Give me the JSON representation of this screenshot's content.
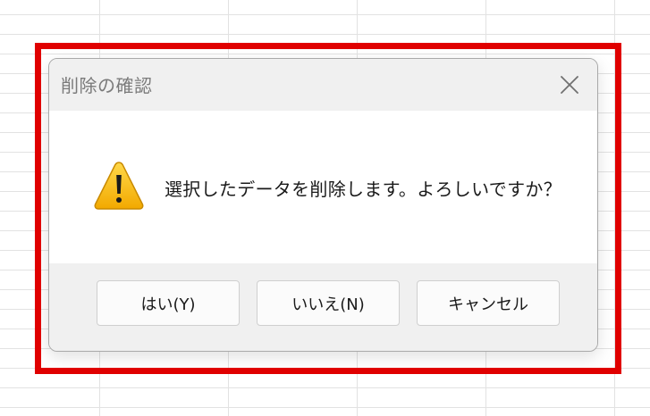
{
  "dialog": {
    "title": "削除の確認",
    "message": "選択したデータを削除します。よろしいですか？",
    "close_icon": "close-icon",
    "warning_icon": "warning-triangle-icon",
    "buttons": {
      "yes": "はい(Y)",
      "no": "いいえ(N)",
      "cancel": "キャンセル"
    }
  },
  "colors": {
    "highlight": "#e00000",
    "warning_fill": "#f7b500",
    "dialog_background": "#f0f0f0",
    "content_background": "#ffffff"
  }
}
